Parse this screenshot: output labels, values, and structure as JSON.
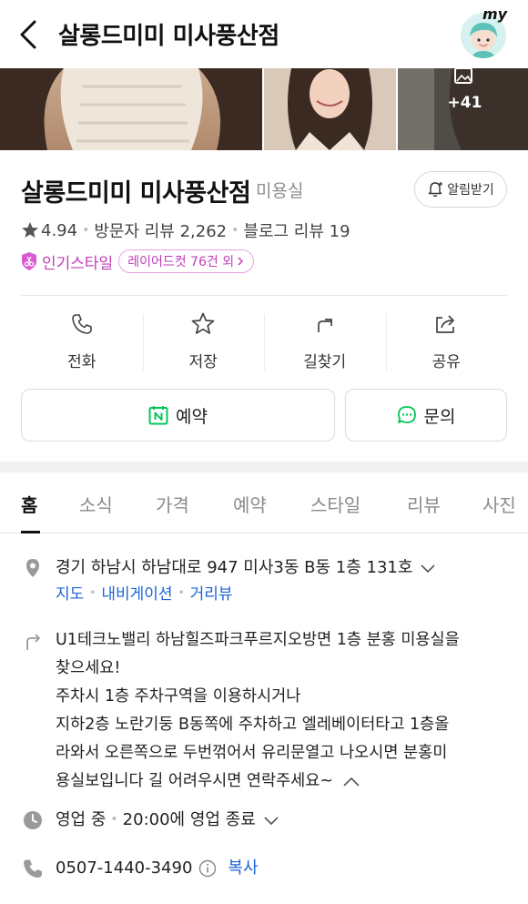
{
  "header": {
    "title": "살롱드미미 미사풍산점",
    "my_label": "my"
  },
  "gallery": {
    "more_count": "+41"
  },
  "place": {
    "name": "살롱드미미 미사풍산점",
    "category": "미용실",
    "alarm_label": "알림받기",
    "rating": "4.94",
    "visitor_review_label": "방문자 리뷰 2,262",
    "blog_review_label": "블로그 리뷰 19",
    "popular_label": "인기스타일",
    "popular_chip": "레이어드컷 76건 외"
  },
  "actions": [
    {
      "label": "전화",
      "icon": "phone-icon"
    },
    {
      "label": "저장",
      "icon": "star-outline-icon"
    },
    {
      "label": "길찾기",
      "icon": "directions-arrow-icon"
    },
    {
      "label": "공유",
      "icon": "share-icon"
    }
  ],
  "buttons": {
    "reserve": "예약",
    "inquiry": "문의"
  },
  "tabs": [
    "홈",
    "소식",
    "가격",
    "예약",
    "스타일",
    "리뷰",
    "사진"
  ],
  "info": {
    "address": "경기 하남시 하남대로 947 미사3동 B동 1층 131호",
    "map_link": "지도",
    "navigation_link": "내비게이션",
    "street_view_link": "거리뷰",
    "directions_lines": [
      "U1테크노밸리 하남힐즈파크푸르지오방면 1층 분홍 미용실을",
      "찾으세요!",
      "주차시 1층 주차구역을 이용하시거나",
      "지하2층 노란기둥 B동쪽에 주차하고 엘레베이터타고 1층올",
      "라와서 오른쪽으로 두번꺾어서 유리문열고 나오시면 분홍미",
      "용실보입니다 길 어려우시면 연락주세요~"
    ],
    "hours_status": "영업 중",
    "hours_detail": "20:00에 영업 종료",
    "phone": "0507-1440-3490",
    "copy_label": "복사"
  },
  "colors": {
    "accent_pink": "#c13dbb",
    "link_blue": "#1b64da",
    "naver_green": "#03c75a"
  }
}
